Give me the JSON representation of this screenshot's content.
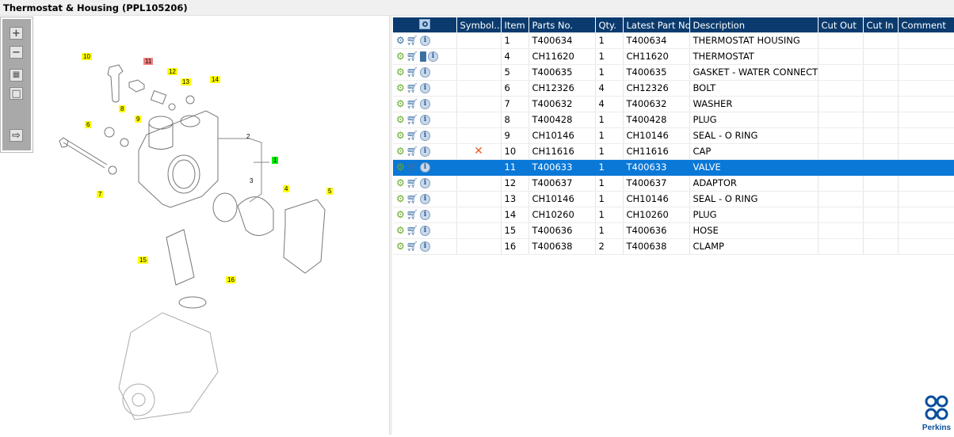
{
  "title": "Thermostat & Housing (PPL105206)",
  "toolbar": {
    "zoom_in": "+",
    "zoom_out": "−",
    "fit_all": "▦",
    "fit_window": "□",
    "export": "⇨"
  },
  "grid": {
    "columns": [
      "",
      "Symbol...",
      "Item",
      "Parts No.",
      "Qty.",
      "Latest Part No.",
      "Description",
      "Cut Out",
      "Cut In",
      "Comment"
    ],
    "rows": [
      {
        "icons": [
          "gears-icon",
          "cart-icon",
          "info-icon"
        ],
        "symbol": "",
        "item": "1",
        "part": "T400634",
        "qty": "1",
        "latest": "T400634",
        "desc": "THERMOSTAT HOUSING",
        "cut_out": "",
        "cut_in": "",
        "comment": ""
      },
      {
        "icons": [
          "gear-icon",
          "cart-icon",
          "book-icon",
          "info-icon"
        ],
        "symbol": "",
        "item": "4",
        "part": "CH11620",
        "qty": "1",
        "latest": "CH11620",
        "desc": "THERMOSTAT",
        "cut_out": "",
        "cut_in": "",
        "comment": ""
      },
      {
        "icons": [
          "gear-icon",
          "cart-icon",
          "info-icon"
        ],
        "symbol": "",
        "item": "5",
        "part": "T400635",
        "qty": "1",
        "latest": "T400635",
        "desc": "GASKET - WATER CONNECTION",
        "cut_out": "",
        "cut_in": "",
        "comment": ""
      },
      {
        "icons": [
          "gear-icon",
          "cart-icon",
          "info-icon"
        ],
        "symbol": "",
        "item": "6",
        "part": "CH12326",
        "qty": "4",
        "latest": "CH12326",
        "desc": "BOLT",
        "cut_out": "",
        "cut_in": "",
        "comment": ""
      },
      {
        "icons": [
          "gear-icon",
          "cart-icon",
          "info-icon"
        ],
        "symbol": "",
        "item": "7",
        "part": "T400632",
        "qty": "4",
        "latest": "T400632",
        "desc": "WASHER",
        "cut_out": "",
        "cut_in": "",
        "comment": ""
      },
      {
        "icons": [
          "gear-icon",
          "cart-icon",
          "info-icon"
        ],
        "symbol": "",
        "item": "8",
        "part": "T400428",
        "qty": "1",
        "latest": "T400428",
        "desc": "PLUG",
        "cut_out": "",
        "cut_in": "",
        "comment": ""
      },
      {
        "icons": [
          "gear-icon",
          "cart-icon",
          "info-icon"
        ],
        "symbol": "",
        "item": "9",
        "part": "CH10146",
        "qty": "1",
        "latest": "CH10146",
        "desc": "SEAL - O RING",
        "cut_out": "",
        "cut_in": "",
        "comment": ""
      },
      {
        "icons": [
          "gear-icon",
          "cart-icon",
          "info-icon"
        ],
        "symbol": "✕",
        "item": "10",
        "part": "CH11616",
        "qty": "1",
        "latest": "CH11616",
        "desc": "CAP",
        "cut_out": "",
        "cut_in": "",
        "comment": ""
      },
      {
        "icons": [
          "gear-icon",
          "cart-icon",
          "info-icon"
        ],
        "symbol": "",
        "item": "11",
        "part": "T400633",
        "qty": "1",
        "latest": "T400633",
        "desc": "VALVE",
        "cut_out": "",
        "cut_in": "",
        "comment": "",
        "selected": true
      },
      {
        "icons": [
          "gear-icon",
          "cart-icon",
          "info-icon"
        ],
        "symbol": "",
        "item": "12",
        "part": "T400637",
        "qty": "1",
        "latest": "T400637",
        "desc": "ADAPTOR",
        "cut_out": "",
        "cut_in": "",
        "comment": ""
      },
      {
        "icons": [
          "gear-icon",
          "cart-icon",
          "info-icon"
        ],
        "symbol": "",
        "item": "13",
        "part": "CH10146",
        "qty": "1",
        "latest": "CH10146",
        "desc": "SEAL - O RING",
        "cut_out": "",
        "cut_in": "",
        "comment": ""
      },
      {
        "icons": [
          "gear-icon",
          "cart-icon",
          "info-icon"
        ],
        "symbol": "",
        "item": "14",
        "part": "CH10260",
        "qty": "1",
        "latest": "CH10260",
        "desc": "PLUG",
        "cut_out": "",
        "cut_in": "",
        "comment": ""
      },
      {
        "icons": [
          "gear-icon",
          "cart-icon",
          "info-icon"
        ],
        "symbol": "",
        "item": "15",
        "part": "T400636",
        "qty": "1",
        "latest": "T400636",
        "desc": "HOSE",
        "cut_out": "",
        "cut_in": "",
        "comment": ""
      },
      {
        "icons": [
          "gear-icon",
          "cart-icon",
          "info-icon"
        ],
        "symbol": "",
        "item": "16",
        "part": "T400638",
        "qty": "2",
        "latest": "T400638",
        "desc": "CLAMP",
        "cut_out": "",
        "cut_in": "",
        "comment": ""
      }
    ]
  },
  "callouts": [
    "10",
    "11",
    "12",
    "13",
    "14",
    "8",
    "9",
    "6",
    "2",
    "1",
    "3",
    "4",
    "5",
    "7",
    "15",
    "16"
  ],
  "callout_colors": {
    "default": "#ffff00",
    "selected": "#f08080",
    "assembly": "#00e000"
  },
  "colors": {
    "header": "#0b3b6e",
    "selection": "#0a78d7",
    "logo": "#0b4f9c"
  },
  "logo": {
    "text": "Perkins"
  }
}
